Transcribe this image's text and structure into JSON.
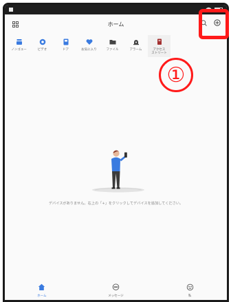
{
  "header": {
    "title": "ホーム"
  },
  "categories": [
    {
      "label": "ノンゴユー",
      "icon": "router-icon",
      "color": "#3a7be0"
    },
    {
      "label": "ビデオ",
      "icon": "camera-icon",
      "color": "#3a7be0"
    },
    {
      "label": "ドア",
      "icon": "door-icon",
      "color": "#3a7be0"
    },
    {
      "label": "お気に入り",
      "icon": "heart-icon",
      "color": "#3a7be0"
    },
    {
      "label": "ファイル",
      "icon": "folder-icon",
      "color": "#444444"
    },
    {
      "label": "アラーム",
      "icon": "alarm-icon",
      "color": "#444444"
    },
    {
      "label": "アクセス\nストリート",
      "icon": "access-icon",
      "color": "#a33030"
    }
  ],
  "annotation": {
    "step": "①",
    "color": "#ff1a1a"
  },
  "empty_state": {
    "message": "デバイスがありません。右上の「+」をクリックしてデバイスを追加してください。"
  },
  "tabs": [
    {
      "label": "ホーム",
      "icon": "home-icon",
      "active": true
    },
    {
      "label": "メッセージ",
      "icon": "message-icon",
      "active": false
    },
    {
      "label": "私",
      "icon": "profile-icon",
      "active": false
    }
  ],
  "accent": "#3a7be0"
}
